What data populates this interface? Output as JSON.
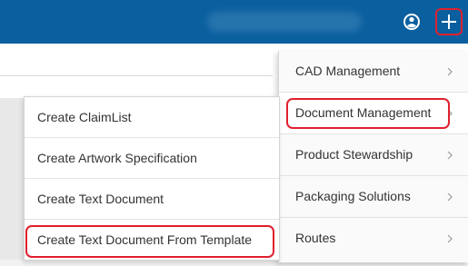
{
  "header": {
    "user_icon": "user-circle-icon",
    "add_icon": "plus-icon"
  },
  "main_menu": {
    "items": [
      {
        "label": "CAD Management",
        "icon": "chevron-right-icon"
      },
      {
        "label": "Document Management",
        "icon": "chevron-right-icon"
      },
      {
        "label": "Product Stewardship",
        "icon": "chevron-right-icon"
      },
      {
        "label": "Packaging Solutions",
        "icon": "chevron-right-icon"
      },
      {
        "label": "Routes",
        "icon": "chevron-right-icon"
      }
    ]
  },
  "submenu": {
    "items": [
      {
        "label": "Create ClaimList"
      },
      {
        "label": "Create Artwork Specification"
      },
      {
        "label": "Create Text Document"
      },
      {
        "label": "Create Text Document From Template"
      }
    ]
  },
  "colors": {
    "header_bg": "#0a5f9e",
    "highlight": "#e0202e"
  }
}
